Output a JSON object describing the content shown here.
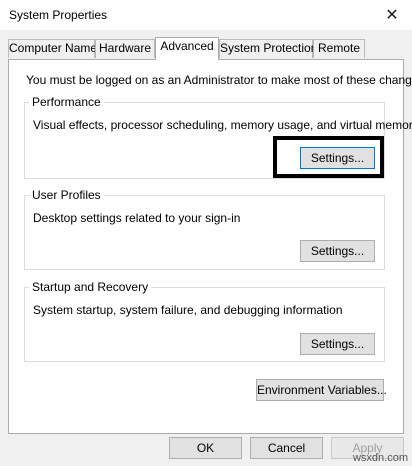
{
  "window": {
    "title": "System Properties"
  },
  "tabs": [
    {
      "label": "Computer Name"
    },
    {
      "label": "Hardware"
    },
    {
      "label": "Advanced",
      "active": true
    },
    {
      "label": "System Protection"
    },
    {
      "label": "Remote"
    }
  ],
  "advanced": {
    "admin_notice": "You must be logged on as an Administrator to make most of these changes.",
    "performance": {
      "label": "Performance",
      "description": "Visual effects, processor scheduling, memory usage, and virtual memory",
      "settings_label": "Settings..."
    },
    "user_profiles": {
      "label": "User Profiles",
      "description": "Desktop settings related to your sign-in",
      "settings_label": "Settings..."
    },
    "startup_recovery": {
      "label": "Startup and Recovery",
      "description": "System startup, system failure, and debugging information",
      "settings_label": "Settings..."
    },
    "env_vars_label": "Environment Variables..."
  },
  "footer": {
    "ok_label": "OK",
    "cancel_label": "Cancel",
    "apply_label": "Apply"
  },
  "watermark": "wsxdn.com",
  "colors": {
    "focus_border": "#0078d7",
    "highlight_box": "#000000",
    "panel_bg": "#ffffff",
    "dialog_bg": "#f0f0f0"
  }
}
